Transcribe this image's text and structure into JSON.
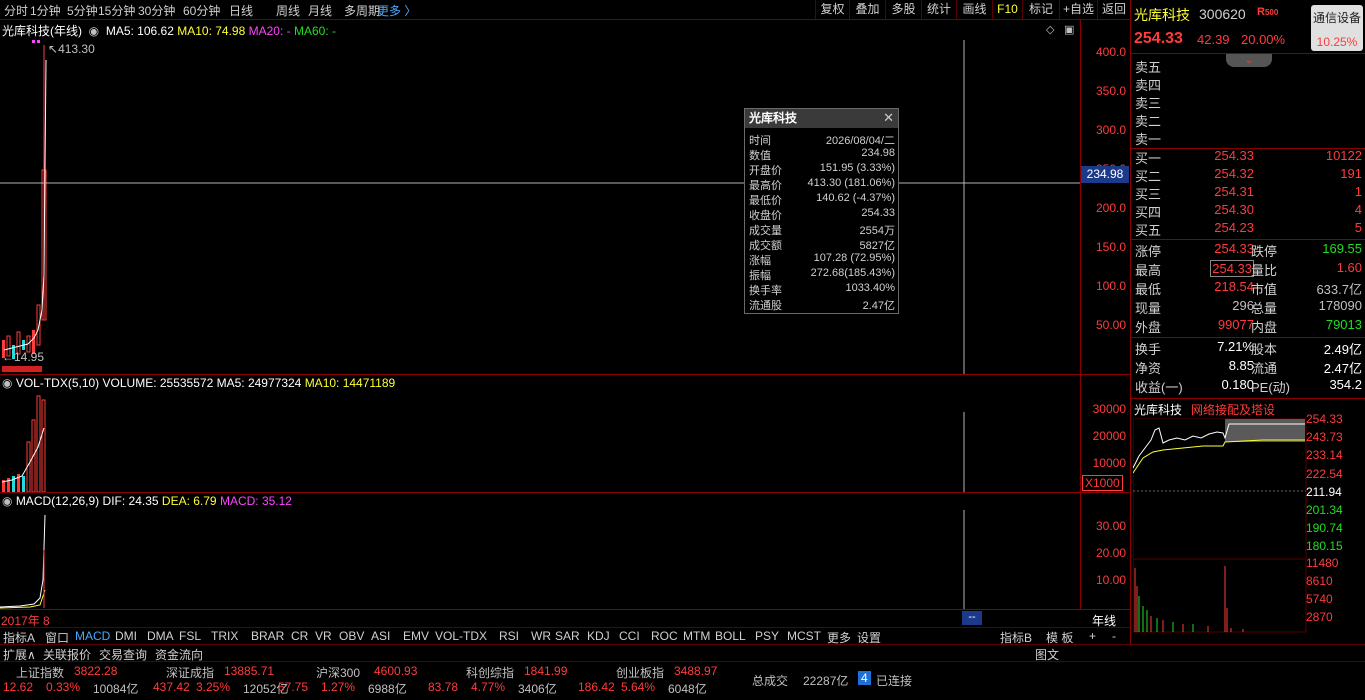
{
  "toolbar": {
    "timeframes": [
      "分时",
      "1分钟",
      "5分钟",
      "15分钟",
      "30分钟",
      "60分钟",
      "日线",
      "周线",
      "月线",
      "多周期",
      "更多 〉"
    ],
    "right_buttons": [
      "复权",
      "叠加",
      "多股",
      "统计",
      "画线",
      "F10",
      "标记",
      "+自选",
      "返回"
    ]
  },
  "main_chart": {
    "title": "光库科技(年线)",
    "ma5": "MA5: 106.62",
    "ma10": "MA10: 74.98",
    "ma20": "MA20: -",
    "ma60": "MA60: -",
    "high_label": "413.30",
    "low_label": "14.95",
    "y_ticks": [
      "400.0",
      "350.0",
      "300.0",
      "250.0",
      "200.0",
      "150.0",
      "100.0",
      "50.00"
    ],
    "crosshair_value": "234.98"
  },
  "volume_chart": {
    "title": "VOL-TDX(5,10)",
    "volume": "VOLUME: 25535572",
    "ma5": "MA5: 24977324",
    "ma10": "MA10: 14471189",
    "y_ticks": [
      "30000",
      "20000",
      "10000"
    ],
    "unit": "X1000"
  },
  "macd_chart": {
    "title": "MACD(12,26,9)",
    "dif": "DIF: 24.35",
    "dea": "DEA: 6.79",
    "macd": "MACD: 35.12",
    "y_ticks": [
      "30.00",
      "20.00",
      "10.00"
    ],
    "x_label": "2017年",
    "x_label2": "8",
    "period": "年线",
    "crosshair_marker": "--"
  },
  "tooltip": {
    "title": "光库科技",
    "rows": [
      {
        "k": "时间",
        "v": "2026/08/04/二",
        "c": "gray"
      },
      {
        "k": "数值",
        "v": "234.98",
        "c": "gray"
      },
      {
        "k": "开盘价",
        "v": "151.95 (3.33%)",
        "c": "red"
      },
      {
        "k": "最高价",
        "v": "413.30 (181.06%)",
        "c": "red"
      },
      {
        "k": "最低价",
        "v": "140.62 (-4.37%)",
        "c": "green"
      },
      {
        "k": "收盘价",
        "v": "254.33",
        "c": "red"
      },
      {
        "k": "成交量",
        "v": "2554万",
        "c": "gray"
      },
      {
        "k": "成交额",
        "v": "5827亿",
        "c": "gray"
      },
      {
        "k": "涨幅",
        "v": "107.28 (72.95%)",
        "c": "red"
      },
      {
        "k": "振幅",
        "v": "272.68(185.43%)",
        "c": "gray"
      },
      {
        "k": "换手率",
        "v": "1033.40%",
        "c": "gray"
      },
      {
        "k": "流通股",
        "v": "2.47亿",
        "c": "gray"
      }
    ]
  },
  "quote": {
    "name": "光库科技",
    "code": "300620",
    "badge": "R",
    "badge_num": "500",
    "industry": "通信设备",
    "industry_pct": "10.25%",
    "price": "254.33",
    "change": "42.39",
    "pct": "20.00%",
    "sells": [
      "卖五",
      "卖四",
      "卖三",
      "卖二",
      "卖一"
    ],
    "buys": [
      {
        "l": "买一",
        "p": "254.33",
        "v": "10122"
      },
      {
        "l": "买二",
        "p": "254.32",
        "v": "191"
      },
      {
        "l": "买三",
        "p": "254.31",
        "v": "1"
      },
      {
        "l": "买四",
        "p": "254.30",
        "v": "4"
      },
      {
        "l": "买五",
        "p": "254.23",
        "v": "5"
      }
    ],
    "stats": [
      {
        "l1": "涨停",
        "v1": "254.33",
        "c1": "red",
        "l2": "跌停",
        "v2": "169.55",
        "c2": "green"
      },
      {
        "l1": "最高",
        "v1": "254.33",
        "c1": "red",
        "l2": "量比",
        "v2": "1.60",
        "c2": "red"
      },
      {
        "l1": "最低",
        "v1": "218.54",
        "c1": "red",
        "l2": "市值",
        "v2": "633.7亿",
        "c2": "gray"
      },
      {
        "l1": "现量",
        "v1": "296",
        "c1": "gray",
        "l2": "总量",
        "v2": "178090",
        "c2": "gray"
      },
      {
        "l1": "外盘",
        "v1": "99077",
        "c1": "red",
        "l2": "内盘",
        "v2": "79013",
        "c2": "green"
      }
    ],
    "stats2": [
      {
        "l1": "换手",
        "v1": "7.21%",
        "l2": "股本",
        "v2": "2.49亿"
      },
      {
        "l1": "净资",
        "v1": "8.85",
        "l2": "流通",
        "v2": "2.47亿"
      },
      {
        "l1": "收益(一)",
        "v1": "0.180",
        "l2": "PE(动)",
        "v2": "354.2"
      }
    ],
    "mini_title": "光库科技",
    "mini_concept": "网络接配及塔设",
    "mini_prices": [
      "254.33",
      "243.73",
      "233.14",
      "222.54",
      "211.94",
      "201.34",
      "190.74",
      "180.15"
    ],
    "mini_vols": [
      "11480",
      "8610",
      "5740",
      "2870"
    ]
  },
  "bottom_tabs": [
    "指标A",
    "窗口",
    "MACD",
    "DMI",
    "DMA",
    "FSL",
    "TRIX",
    "BRAR",
    "CR",
    "VR",
    "OBV",
    "ASI",
    "EMV",
    "VOL-TDX",
    "RSI",
    "WR",
    "SAR",
    "KDJ",
    "CCI",
    "ROC",
    "MTM",
    "BOLL",
    "PSY",
    "MCST",
    "更多",
    "设置"
  ],
  "right_tabs": [
    "指标B",
    "模 板",
    "+",
    "-"
  ],
  "func_bar": [
    "扩展∧",
    "关联报价",
    "交易查询",
    "资金流向"
  ],
  "func_right": "图文",
  "indices": [
    {
      "name": "上证指数",
      "val": "3822.28",
      "chg": "12.62",
      "pct": "0.33%",
      "amt": "10084亿"
    },
    {
      "name": "深证成指",
      "val": "13885.71",
      "chg": "437.42",
      "pct": "3.25%",
      "amt": "12052亿"
    },
    {
      "name": "沪深300",
      "val": "4600.93",
      "chg": "57.75",
      "pct": "1.27%",
      "amt": "6988亿"
    },
    {
      "name": "科创综指",
      "val": "1841.99",
      "chg": "83.78",
      "pct": "4.77%",
      "amt": "3406亿"
    },
    {
      "name": "创业板指",
      "val": "3488.97",
      "chg": "186.42",
      "pct": "5.64%",
      "amt": "6048亿"
    }
  ],
  "total_label": "总成交",
  "total_amt": "22287亿",
  "conn_num": "4",
  "conn_label": "已连接"
}
